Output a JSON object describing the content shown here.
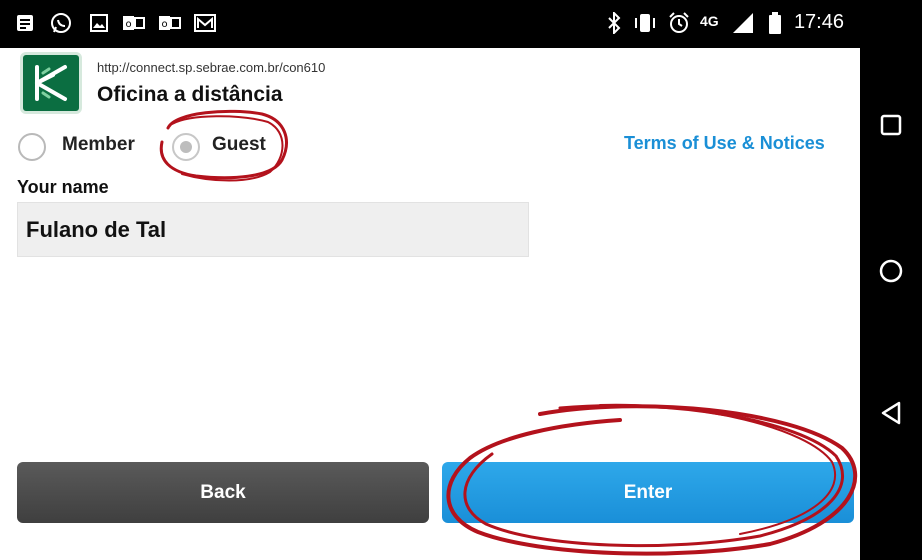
{
  "status_bar": {
    "time": "17:46",
    "network": "4G",
    "left_icons": [
      "notes-icon",
      "whatsapp-icon",
      "gallery-icon",
      "outlook-icon",
      "outlook-icon",
      "gmail-icon"
    ],
    "right_icons": [
      "bluetooth-icon",
      "vibrate-icon",
      "alarm-icon",
      "signal-icon",
      "battery-icon"
    ]
  },
  "app": {
    "url": "http://connect.sp.sebrae.com.br/con610",
    "title": "Oficina a distância",
    "logo_icon": "adobe-connect-logo-icon",
    "brand_color": "#0b6e41"
  },
  "login_type": {
    "options": [
      {
        "label": "Member",
        "selected": false
      },
      {
        "label": "Guest",
        "selected": true
      }
    ]
  },
  "terms_link": "Terms of Use & Notices",
  "name_field": {
    "label": "Your name",
    "value": "Fulano de Tal"
  },
  "buttons": {
    "back": "Back",
    "enter": "Enter"
  },
  "navbar": {
    "icons": [
      "recents-square-icon",
      "home-circle-icon",
      "back-triangle-icon"
    ]
  },
  "colors": {
    "accent": "#1a8fd6",
    "annotation": "#b3121c"
  }
}
